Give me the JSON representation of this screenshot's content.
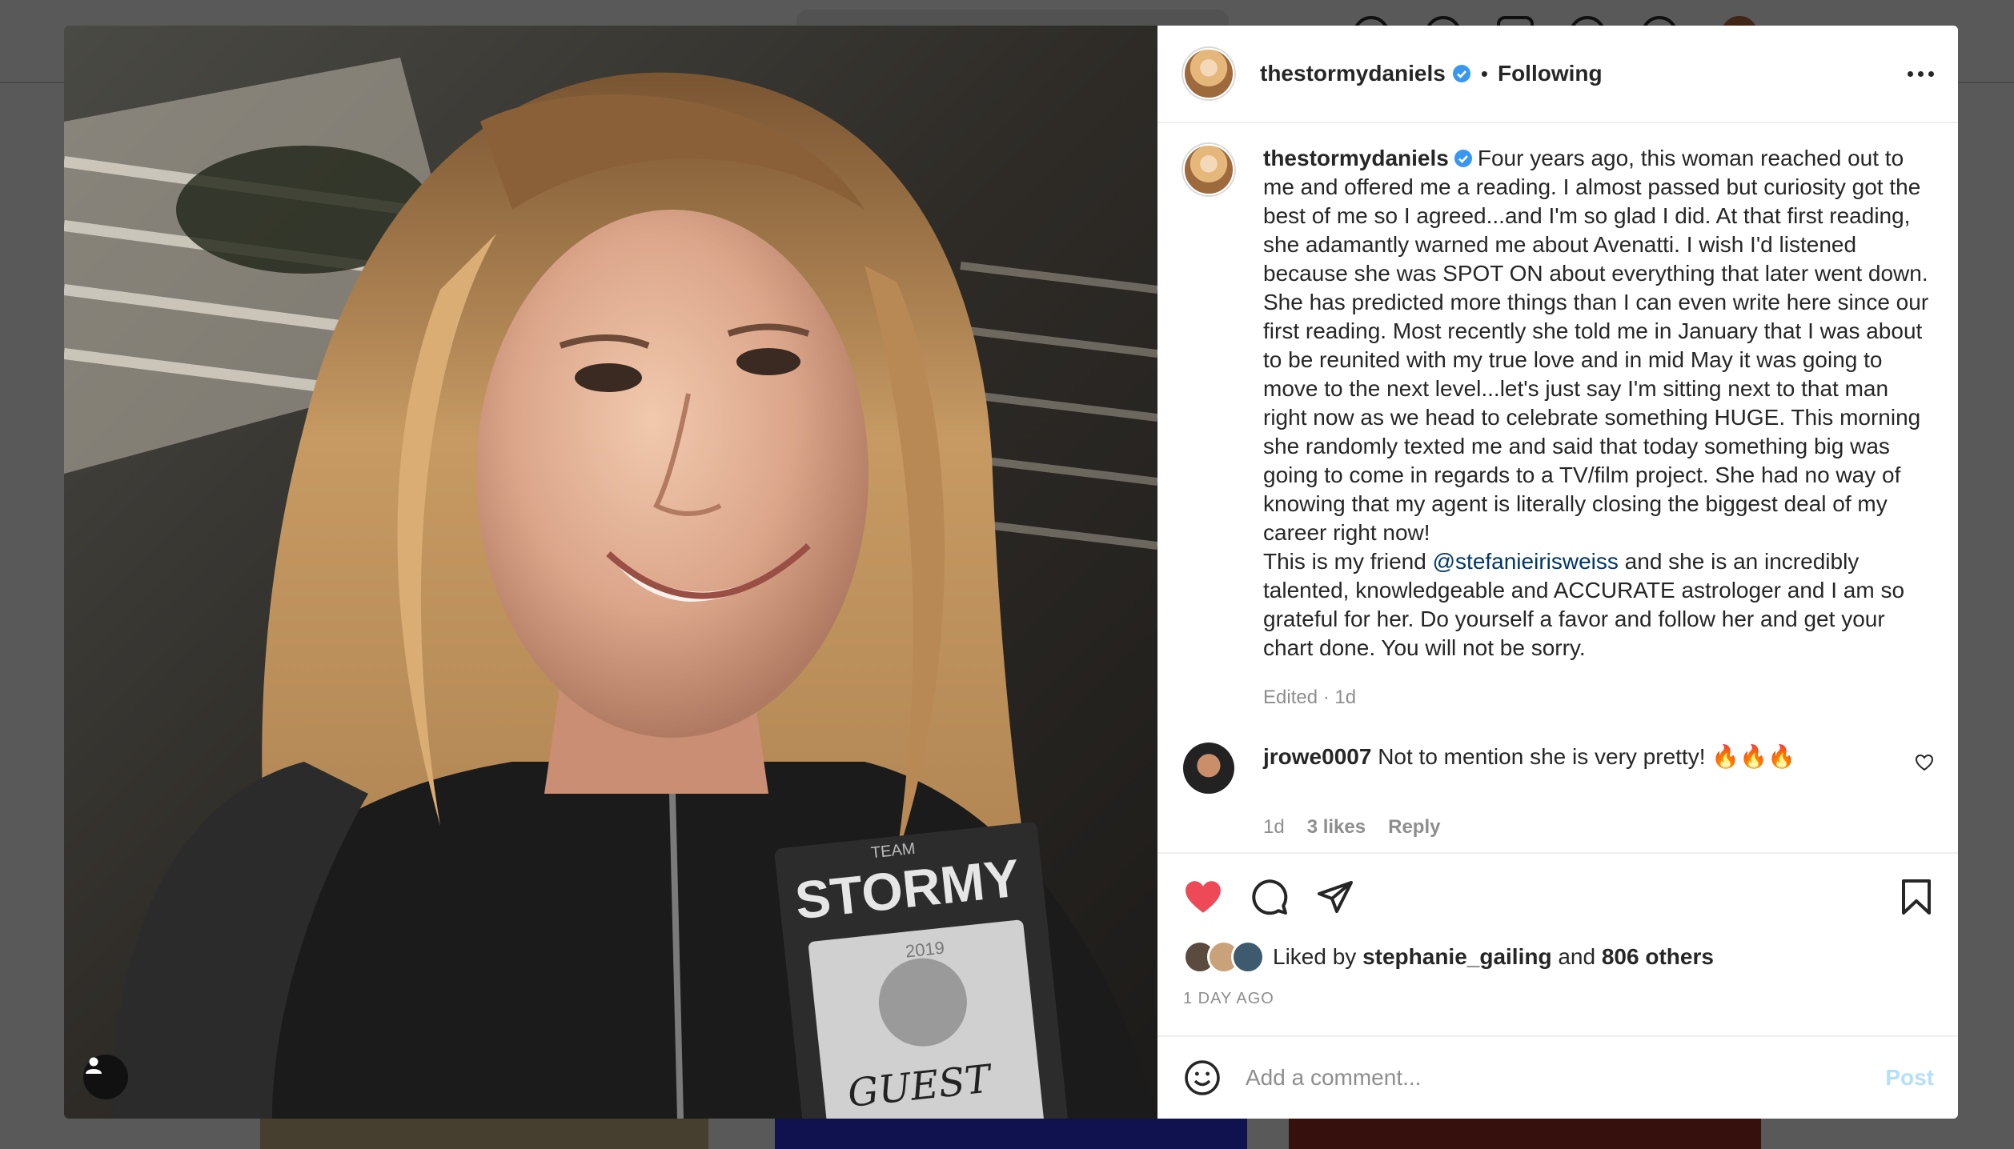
{
  "post": {
    "username": "thestormydaniels",
    "follow_status": "Following",
    "caption_main": "Four years ago, this woman reached out to me and offered me a reading. I almost passed but curiosity got the best of me so I agreed...and I'm so glad I did. At that first reading, she adamantly warned me about Avenatti. I wish I'd listened because she was SPOT ON about everything that later went down. She has predicted more things than I can even write here since our first reading. Most recently she told me in January that I was about to be reunited with my true love and in mid May it was going to move to the next level...let's just say I'm sitting next to that man right now as we head to celebrate something HUGE. This morning she randomly texted me and said that today something big was going to come in regards to a TV/film project. She had no way of knowing that my agent is literally closing the biggest deal of my career right now!",
    "caption_lead": "This is my friend",
    "mention": "@stefanieirisweiss",
    "caption_tail": "and she is an incredibly talented, knowledgeable and ACCURATE astrologer and I am so grateful for her. Do yourself a favor and follow her and get your chart done. You will not be sorry.",
    "edited": "Edited · 1d",
    "photo_text": {
      "team": "TEAM",
      "brand": "STORMY",
      "year": "2019",
      "guest": "GUEST"
    }
  },
  "comment": {
    "username": "jrowe0007",
    "text": "Not to mention she is very pretty! 🔥🔥🔥",
    "age": "1d",
    "likes": "3 likes",
    "reply": "Reply"
  },
  "likes": {
    "prefix": "Liked by",
    "user": "stephanie_gailing",
    "and": "and",
    "others": "806 others",
    "face_colors": [
      "#5b4a3e",
      "#c9a27c",
      "#3d5a6e"
    ]
  },
  "timestamp": "1 DAY AGO",
  "add_comment": {
    "placeholder": "Add a comment...",
    "post": "Post"
  },
  "colors": {
    "like_red": "#ed4956",
    "verified_blue": "#3897f0",
    "link_blue": "#00376b",
    "post_disabled": "#b2dffc"
  },
  "icons": [
    "heart-icon",
    "comment-icon",
    "share-icon",
    "bookmark-icon",
    "emoji-icon",
    "more-icon",
    "verified-badge-icon",
    "user-tag-icon"
  ]
}
